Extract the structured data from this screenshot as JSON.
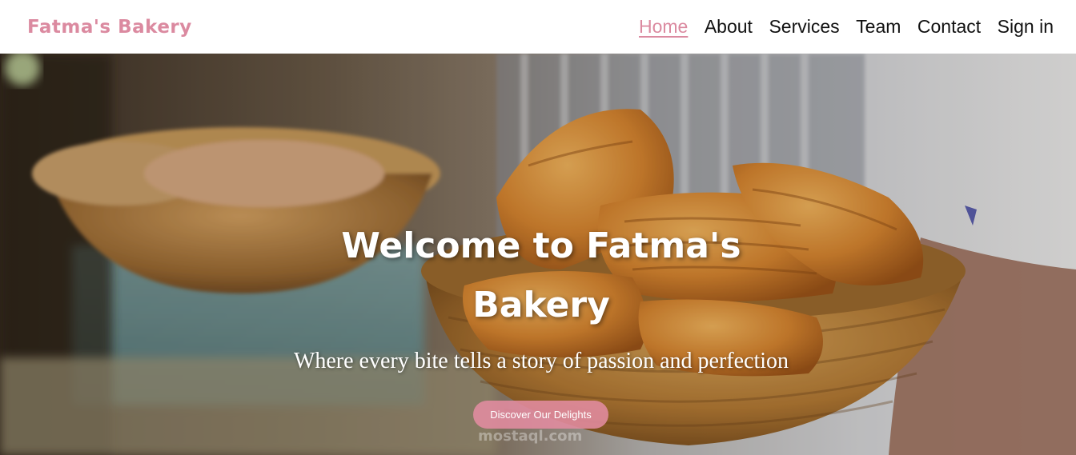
{
  "brand": {
    "name": "Fatma's Bakery"
  },
  "nav": {
    "items": [
      {
        "label": "Home",
        "active": true
      },
      {
        "label": "About",
        "active": false
      },
      {
        "label": "Services",
        "active": false
      },
      {
        "label": "Team",
        "active": false
      },
      {
        "label": "Contact",
        "active": false
      },
      {
        "label": "Sign in",
        "active": false
      }
    ]
  },
  "hero": {
    "title_line1": "Welcome to Fatma's",
    "title_line2": "Bakery",
    "subtitle": "Where every bite tells a story of passion and perfection",
    "cta_label": "Discover Our Delights",
    "watermark": "mostaql.com"
  },
  "colors": {
    "brand_pink": "#db8aa0",
    "nav_text": "#111111",
    "button_pink": "#e28ca0",
    "hero_text": "#ffffff"
  }
}
